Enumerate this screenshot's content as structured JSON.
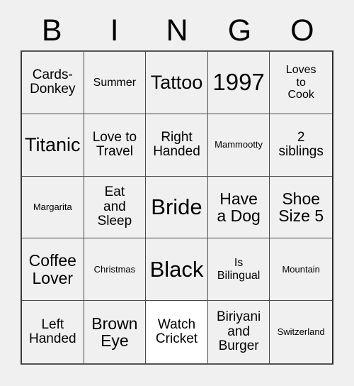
{
  "card": {
    "title_letters": [
      "B",
      "I",
      "N",
      "G",
      "O"
    ],
    "columns": 5,
    "rows": 5,
    "background_color": "#f0f0f0",
    "cell_background_color": "#f0f0f0",
    "marked_cell_background_color": "#ffffff",
    "border_color": "#4a4a4a",
    "text_color": "#000000"
  },
  "cells": [
    {
      "text": "Cards-\nDonkey",
      "size": "md",
      "marked": false
    },
    {
      "text": "Summer",
      "size": "sm",
      "marked": false
    },
    {
      "text": "Tattoo",
      "size": "xl",
      "marked": false
    },
    {
      "text": "1997",
      "size": "num",
      "marked": false
    },
    {
      "text": "Loves\nto\nCook",
      "size": "sm",
      "marked": false
    },
    {
      "text": "Titanic",
      "size": "xl",
      "marked": false
    },
    {
      "text": "Love to\nTravel",
      "size": "md",
      "marked": false
    },
    {
      "text": "Right\nHanded",
      "size": "md",
      "marked": false
    },
    {
      "text": "Mammootty",
      "size": "xs",
      "marked": false
    },
    {
      "text": "2\nsiblings",
      "size": "md",
      "marked": false
    },
    {
      "text": "Margarita",
      "size": "xs",
      "marked": false
    },
    {
      "text": "Eat\nand\nSleep",
      "size": "md",
      "marked": false
    },
    {
      "text": "Bride",
      "size": "xxl",
      "marked": false
    },
    {
      "text": "Have\na Dog",
      "size": "lg",
      "marked": false
    },
    {
      "text": "Shoe\nSize 5",
      "size": "lg",
      "marked": false
    },
    {
      "text": "Coffee\nLover",
      "size": "lg",
      "marked": false
    },
    {
      "text": "Christmas",
      "size": "xs",
      "marked": false
    },
    {
      "text": "Black",
      "size": "xxl",
      "marked": false
    },
    {
      "text": "Is\nBilingual",
      "size": "sm",
      "marked": false
    },
    {
      "text": "Mountain",
      "size": "xs",
      "marked": false
    },
    {
      "text": "Left\nHanded",
      "size": "md",
      "marked": false
    },
    {
      "text": "Brown\nEye",
      "size": "lg",
      "marked": false
    },
    {
      "text": "Watch\nCricket",
      "size": "md",
      "marked": true
    },
    {
      "text": "Biriyani\nand\nBurger",
      "size": "md",
      "marked": false
    },
    {
      "text": "Switzerland",
      "size": "xs",
      "marked": false
    }
  ]
}
